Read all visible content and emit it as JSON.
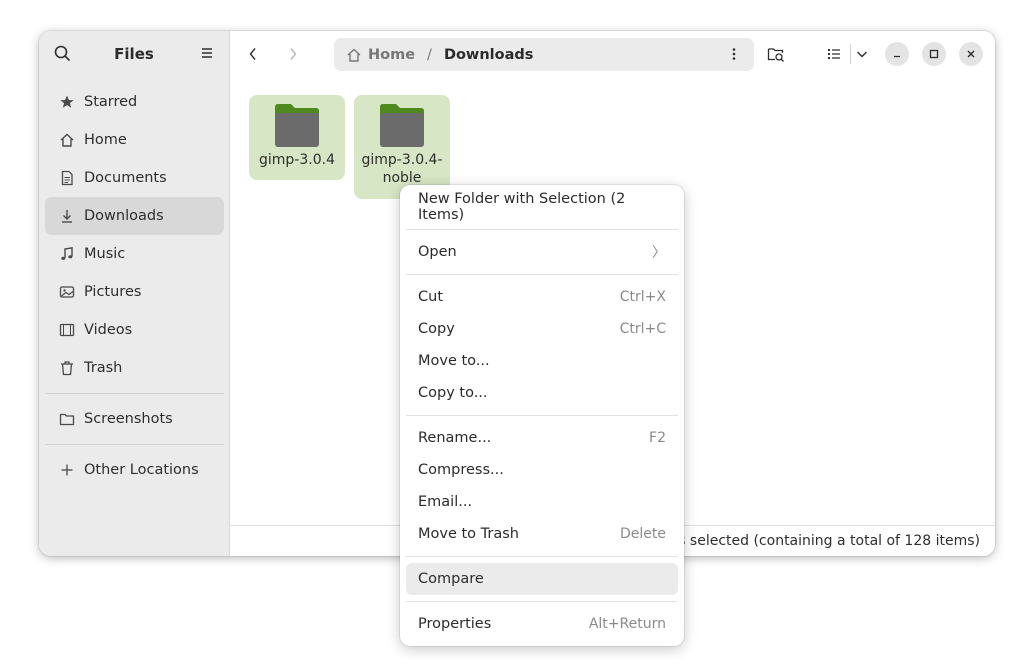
{
  "sidebar": {
    "title": "Files",
    "items": [
      {
        "label": "Starred",
        "icon": "star-icon"
      },
      {
        "label": "Home",
        "icon": "home-icon"
      },
      {
        "label": "Documents",
        "icon": "document-icon"
      },
      {
        "label": "Downloads",
        "icon": "download-icon",
        "active": true
      },
      {
        "label": "Music",
        "icon": "music-icon"
      },
      {
        "label": "Pictures",
        "icon": "picture-icon"
      },
      {
        "label": "Videos",
        "icon": "video-icon"
      },
      {
        "label": "Trash",
        "icon": "trash-icon"
      }
    ],
    "bookmarks": [
      {
        "label": "Screenshots",
        "icon": "folder-icon"
      }
    ],
    "other": {
      "label": "Other Locations",
      "icon": "plus-icon"
    }
  },
  "pathbar": {
    "home": "Home",
    "separator": "/",
    "current": "Downloads"
  },
  "files": [
    {
      "name": "gimp-3.0.4"
    },
    {
      "name": "gimp-3.0.4-noble"
    }
  ],
  "status": "rs selected  (containing a total of 128 items)",
  "context_menu": {
    "items": [
      {
        "label": "New Folder with Selection (2 Items)",
        "accel": ""
      },
      {
        "sep": true
      },
      {
        "label": "Open",
        "accel": "〉"
      },
      {
        "sep": true
      },
      {
        "label": "Cut",
        "accel": "Ctrl+X"
      },
      {
        "label": "Copy",
        "accel": "Ctrl+C"
      },
      {
        "label": "Move to...",
        "accel": ""
      },
      {
        "label": "Copy to...",
        "accel": ""
      },
      {
        "sep": true
      },
      {
        "label": "Rename...",
        "accel": "F2"
      },
      {
        "label": "Compress...",
        "accel": ""
      },
      {
        "label": "Email...",
        "accel": ""
      },
      {
        "label": "Move to Trash",
        "accel": "Delete"
      },
      {
        "sep": true
      },
      {
        "label": "Compare",
        "accel": "",
        "hover": true
      },
      {
        "sep": true
      },
      {
        "label": "Properties",
        "accel": "Alt+Return"
      }
    ]
  },
  "colors": {
    "accent_selection": "#d7e6c4",
    "folder_body": "#6b6b6b",
    "folder_tab": "#4e8a1f"
  }
}
